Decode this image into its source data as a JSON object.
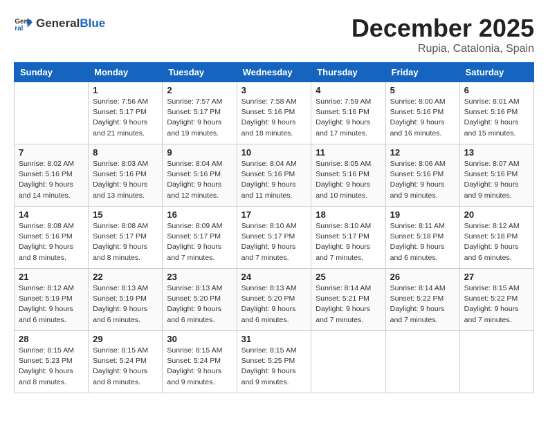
{
  "header": {
    "logo_general": "General",
    "logo_blue": "Blue",
    "month": "December 2025",
    "location": "Rupia, Catalonia, Spain"
  },
  "days_of_week": [
    "Sunday",
    "Monday",
    "Tuesday",
    "Wednesday",
    "Thursday",
    "Friday",
    "Saturday"
  ],
  "weeks": [
    [
      {
        "day": "",
        "info": ""
      },
      {
        "day": "1",
        "info": "Sunrise: 7:56 AM\nSunset: 5:17 PM\nDaylight: 9 hours\nand 21 minutes."
      },
      {
        "day": "2",
        "info": "Sunrise: 7:57 AM\nSunset: 5:17 PM\nDaylight: 9 hours\nand 19 minutes."
      },
      {
        "day": "3",
        "info": "Sunrise: 7:58 AM\nSunset: 5:16 PM\nDaylight: 9 hours\nand 18 minutes."
      },
      {
        "day": "4",
        "info": "Sunrise: 7:59 AM\nSunset: 5:16 PM\nDaylight: 9 hours\nand 17 minutes."
      },
      {
        "day": "5",
        "info": "Sunrise: 8:00 AM\nSunset: 5:16 PM\nDaylight: 9 hours\nand 16 minutes."
      },
      {
        "day": "6",
        "info": "Sunrise: 8:01 AM\nSunset: 5:16 PM\nDaylight: 9 hours\nand 15 minutes."
      }
    ],
    [
      {
        "day": "7",
        "info": "Sunrise: 8:02 AM\nSunset: 5:16 PM\nDaylight: 9 hours\nand 14 minutes."
      },
      {
        "day": "8",
        "info": "Sunrise: 8:03 AM\nSunset: 5:16 PM\nDaylight: 9 hours\nand 13 minutes."
      },
      {
        "day": "9",
        "info": "Sunrise: 8:04 AM\nSunset: 5:16 PM\nDaylight: 9 hours\nand 12 minutes."
      },
      {
        "day": "10",
        "info": "Sunrise: 8:04 AM\nSunset: 5:16 PM\nDaylight: 9 hours\nand 11 minutes."
      },
      {
        "day": "11",
        "info": "Sunrise: 8:05 AM\nSunset: 5:16 PM\nDaylight: 9 hours\nand 10 minutes."
      },
      {
        "day": "12",
        "info": "Sunrise: 8:06 AM\nSunset: 5:16 PM\nDaylight: 9 hours\nand 9 minutes."
      },
      {
        "day": "13",
        "info": "Sunrise: 8:07 AM\nSunset: 5:16 PM\nDaylight: 9 hours\nand 9 minutes."
      }
    ],
    [
      {
        "day": "14",
        "info": "Sunrise: 8:08 AM\nSunset: 5:16 PM\nDaylight: 9 hours\nand 8 minutes."
      },
      {
        "day": "15",
        "info": "Sunrise: 8:08 AM\nSunset: 5:17 PM\nDaylight: 9 hours\nand 8 minutes."
      },
      {
        "day": "16",
        "info": "Sunrise: 8:09 AM\nSunset: 5:17 PM\nDaylight: 9 hours\nand 7 minutes."
      },
      {
        "day": "17",
        "info": "Sunrise: 8:10 AM\nSunset: 5:17 PM\nDaylight: 9 hours\nand 7 minutes."
      },
      {
        "day": "18",
        "info": "Sunrise: 8:10 AM\nSunset: 5:17 PM\nDaylight: 9 hours\nand 7 minutes."
      },
      {
        "day": "19",
        "info": "Sunrise: 8:11 AM\nSunset: 5:18 PM\nDaylight: 9 hours\nand 6 minutes."
      },
      {
        "day": "20",
        "info": "Sunrise: 8:12 AM\nSunset: 5:18 PM\nDaylight: 9 hours\nand 6 minutes."
      }
    ],
    [
      {
        "day": "21",
        "info": "Sunrise: 8:12 AM\nSunset: 5:19 PM\nDaylight: 9 hours\nand 6 minutes."
      },
      {
        "day": "22",
        "info": "Sunrise: 8:13 AM\nSunset: 5:19 PM\nDaylight: 9 hours\nand 6 minutes."
      },
      {
        "day": "23",
        "info": "Sunrise: 8:13 AM\nSunset: 5:20 PM\nDaylight: 9 hours\nand 6 minutes."
      },
      {
        "day": "24",
        "info": "Sunrise: 8:13 AM\nSunset: 5:20 PM\nDaylight: 9 hours\nand 6 minutes."
      },
      {
        "day": "25",
        "info": "Sunrise: 8:14 AM\nSunset: 5:21 PM\nDaylight: 9 hours\nand 7 minutes."
      },
      {
        "day": "26",
        "info": "Sunrise: 8:14 AM\nSunset: 5:22 PM\nDaylight: 9 hours\nand 7 minutes."
      },
      {
        "day": "27",
        "info": "Sunrise: 8:15 AM\nSunset: 5:22 PM\nDaylight: 9 hours\nand 7 minutes."
      }
    ],
    [
      {
        "day": "28",
        "info": "Sunrise: 8:15 AM\nSunset: 5:23 PM\nDaylight: 9 hours\nand 8 minutes."
      },
      {
        "day": "29",
        "info": "Sunrise: 8:15 AM\nSunset: 5:24 PM\nDaylight: 9 hours\nand 8 minutes."
      },
      {
        "day": "30",
        "info": "Sunrise: 8:15 AM\nSunset: 5:24 PM\nDaylight: 9 hours\nand 9 minutes."
      },
      {
        "day": "31",
        "info": "Sunrise: 8:15 AM\nSunset: 5:25 PM\nDaylight: 9 hours\nand 9 minutes."
      },
      {
        "day": "",
        "info": ""
      },
      {
        "day": "",
        "info": ""
      },
      {
        "day": "",
        "info": ""
      }
    ]
  ]
}
